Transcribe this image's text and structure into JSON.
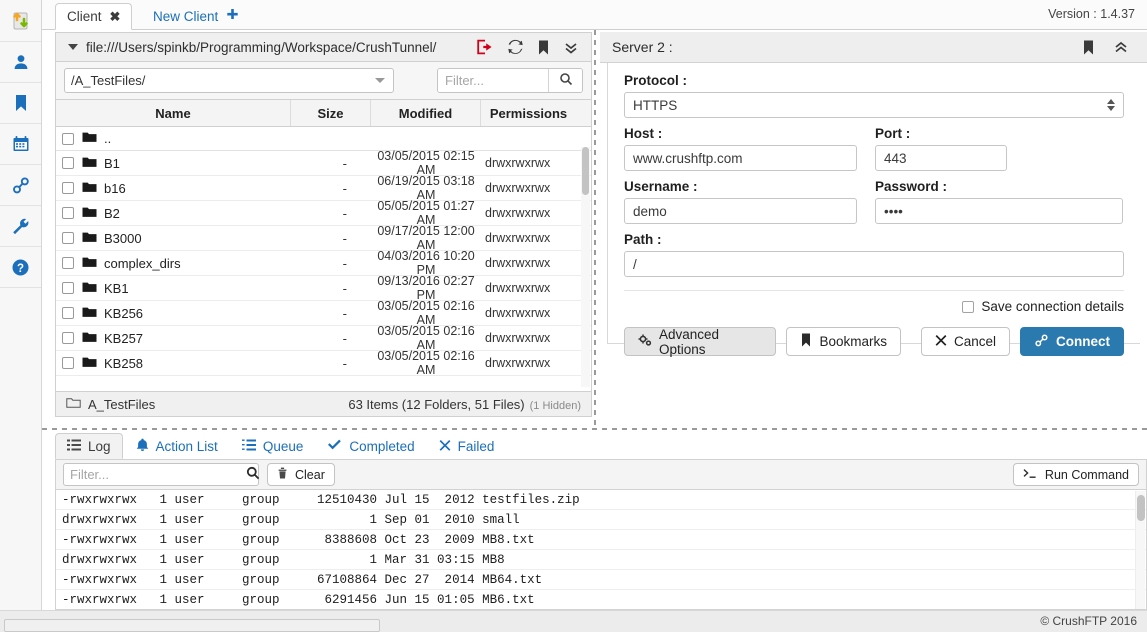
{
  "rail": {
    "items": [
      {
        "icon": "transfer-icon",
        "label": "Transfers"
      },
      {
        "icon": "user-icon",
        "label": "User"
      },
      {
        "icon": "bookmark-icon",
        "label": "Bookmarks"
      },
      {
        "icon": "calendar-icon",
        "label": "Scheduler"
      },
      {
        "icon": "link-icon",
        "label": "Links"
      },
      {
        "icon": "wrench-icon",
        "label": "Tools"
      },
      {
        "icon": "help-icon",
        "label": "Help"
      }
    ]
  },
  "tabs": {
    "active": {
      "label": "Client",
      "close": "✖"
    },
    "new": {
      "label": "New Client",
      "plus": "➕"
    }
  },
  "header": {
    "version": "Version : 1.4.37"
  },
  "browser": {
    "path": "file:///Users/spinkb/Programming/Workspace/CrushTunnel/",
    "path_icons": [
      "disconnect-icon",
      "refresh-icon",
      "bookmark-icon",
      "chevron-down-icon"
    ],
    "directory_select": "/A_TestFiles/",
    "filter_placeholder": "Filter...",
    "filter_value": "",
    "columns": [
      "Name",
      "Size",
      "Modified",
      "Permissions"
    ],
    "rows": [
      {
        "name": "..",
        "size": "",
        "modified": "",
        "permissions": ""
      },
      {
        "name": "B1",
        "size": "-",
        "modified": "03/05/2015 02:15 AM",
        "permissions": "drwxrwxrwx"
      },
      {
        "name": "b16",
        "size": "-",
        "modified": "06/19/2015 03:18 AM",
        "permissions": "drwxrwxrwx"
      },
      {
        "name": "B2",
        "size": "-",
        "modified": "05/05/2015 01:27 AM",
        "permissions": "drwxrwxrwx"
      },
      {
        "name": "B3000",
        "size": "-",
        "modified": "09/17/2015 12:00 AM",
        "permissions": "drwxrwxrwx"
      },
      {
        "name": "complex_dirs",
        "size": "-",
        "modified": "04/03/2016 10:20 PM",
        "permissions": "drwxrwxrwx"
      },
      {
        "name": "KB1",
        "size": "-",
        "modified": "09/13/2016 02:27 PM",
        "permissions": "drwxrwxrwx"
      },
      {
        "name": "KB256",
        "size": "-",
        "modified": "03/05/2015 02:16 AM",
        "permissions": "drwxrwxrwx"
      },
      {
        "name": "KB257",
        "size": "-",
        "modified": "03/05/2015 02:16 AM",
        "permissions": "drwxrwxrwx"
      },
      {
        "name": "KB258",
        "size": "-",
        "modified": "03/05/2015 02:16 AM",
        "permissions": "drwxrwxrwx"
      }
    ],
    "status": {
      "folder": "A_TestFiles",
      "summary": "63 Items (12 Folders, 51 Files)",
      "hidden": "(1 Hidden)"
    }
  },
  "server": {
    "title": "Server 2 :",
    "head_icons": [
      "bookmark-icon",
      "collapse-up-icon"
    ],
    "fields": {
      "protocol_label": "Protocol :",
      "protocol_value": "HTTPS",
      "host_label": "Host :",
      "host_value": "www.crushftp.com",
      "port_label": "Port :",
      "port_value": "443",
      "username_label": "Username :",
      "username_value": "demo",
      "password_label": "Password :",
      "password_value": "••••",
      "path_label": "Path :",
      "path_value": "/"
    },
    "save_label": "Save connection details",
    "buttons": {
      "advanced": "Advanced Options",
      "bookmarks": "Bookmarks",
      "cancel": "Cancel",
      "connect": "Connect"
    }
  },
  "log": {
    "tabs": [
      {
        "label": "Log",
        "icon": "list-icon",
        "active": true
      },
      {
        "label": "Action List",
        "icon": "bell-icon",
        "active": false
      },
      {
        "label": "Queue",
        "icon": "queue-icon",
        "active": false
      },
      {
        "label": "Completed",
        "icon": "check-icon",
        "active": false
      },
      {
        "label": "Failed",
        "icon": "x-icon",
        "active": false
      }
    ],
    "filter_placeholder": "Filter...",
    "filter_value": "",
    "clear_label": "Clear",
    "run_command_label": "Run Command",
    "lines": [
      "-rwxrwxrwx   1 user     group     12510430 Jul 15  2012 testfiles.zip",
      "drwxrwxrwx   1 user     group            1 Sep 01  2010 small",
      "-rwxrwxrwx   1 user     group      8388608 Oct 23  2009 MB8.txt",
      "drwxrwxrwx   1 user     group            1 Mar 31 03:15 MB8",
      "-rwxrwxrwx   1 user     group     67108864 Dec 27  2014 MB64.txt",
      "-rwxrwxrwx   1 user     group      6291456 Jun 15 01:05 MB6.txt"
    ]
  },
  "footer": {
    "copyright": "© CrushFTP 2016"
  },
  "colors": {
    "accent": "#1c6fba",
    "primary_button": "#2a7ab0",
    "danger": "#d0021b"
  }
}
